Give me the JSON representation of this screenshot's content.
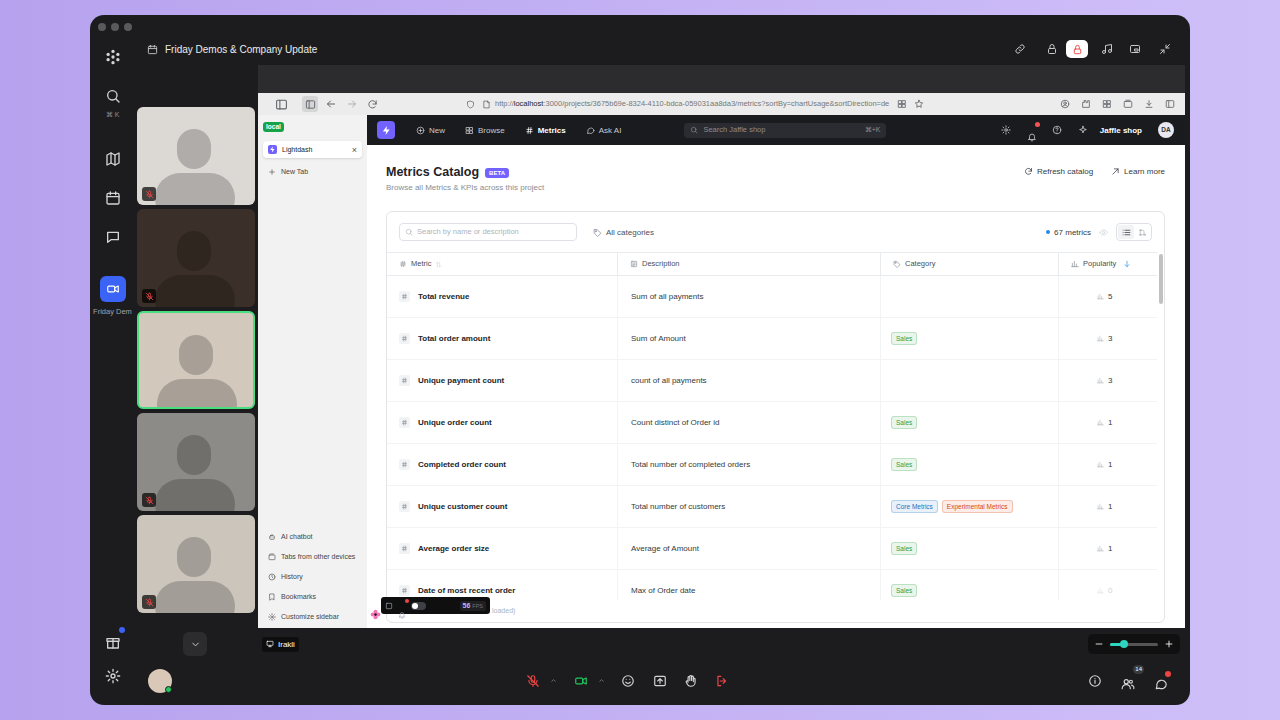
{
  "window": {
    "title": "Friday Demos & Company Update"
  },
  "rail": {
    "shortcut": "⌘ K",
    "meeting": {
      "label": "Friday Dem",
      "selected": true
    },
    "gift_dot": true
  },
  "participants": [
    {
      "muted": true,
      "speaking": false
    },
    {
      "muted": true,
      "speaking": false
    },
    {
      "muted": false,
      "speaking": true
    },
    {
      "muted": true,
      "speaking": false
    },
    {
      "muted": true,
      "speaking": false
    }
  ],
  "share": {
    "presenter": "Irakli",
    "zoom": {
      "level": 0.3
    }
  },
  "browser": {
    "url": {
      "scheme": "http://",
      "host": "localhost",
      "rest": ":3000/projects/3675b69e-8324-4110-bdca-059031aa8da3/metrics?sortBy=chartUsage&sortDirection=de"
    },
    "profile": "local",
    "tabs": [
      {
        "label": "Lightdash",
        "selected": true,
        "close": "×"
      }
    ],
    "new_tab": "New Tab",
    "links": [
      "AI chatbot",
      "Tabs from other devices",
      "History",
      "Bookmarks",
      "Customize sidebar"
    ]
  },
  "app": {
    "nav": [
      {
        "label": "New",
        "selected": false
      },
      {
        "label": "Browse",
        "selected": false
      },
      {
        "label": "Metrics",
        "selected": true
      },
      {
        "label": "Ask AI",
        "selected": false
      }
    ],
    "search": {
      "placeholder": "Search Jaffle shop",
      "shortcut": "⌘+K"
    },
    "notification_dot": true,
    "project": "Jaffle shop",
    "avatar": "DA"
  },
  "page": {
    "title": "Metrics Catalog",
    "badge": "BETA",
    "subtitle": "Browse all Metrics & KPIs across this project",
    "actions": [
      "Refresh catalog",
      "Learn more"
    ]
  },
  "table": {
    "search": {
      "placeholder": "Search by name or description"
    },
    "filter": "All categories",
    "count": "67 metrics",
    "views": [
      {
        "kind": "list",
        "selected": true
      },
      {
        "kind": "tree",
        "selected": false
      }
    ],
    "columns": [
      {
        "label": "Metric",
        "sortable": true,
        "sorted": false
      },
      {
        "label": "Description",
        "sortable": false,
        "sorted": false
      },
      {
        "label": "Category",
        "sortable": false,
        "sorted": false
      },
      {
        "label": "Popularity",
        "sortable": true,
        "sorted": true
      }
    ],
    "rows": [
      {
        "name": "Total revenue",
        "description": "Sum of all payments",
        "categories": [],
        "popularity": {
          "value": "5",
          "dim": false
        }
      },
      {
        "name": "Total order amount",
        "description": "Sum of Amount",
        "categories": [
          {
            "label": "Sales",
            "color": "#2f9e44"
          }
        ],
        "popularity": {
          "value": "3",
          "dim": false
        }
      },
      {
        "name": "Unique payment count",
        "description": "count of all payments",
        "categories": [],
        "popularity": {
          "value": "3",
          "dim": false
        }
      },
      {
        "name": "Unique order count",
        "description": "Count distinct of Order id",
        "categories": [
          {
            "label": "Sales",
            "color": "#2f9e44"
          }
        ],
        "popularity": {
          "value": "1",
          "dim": false
        }
      },
      {
        "name": "Completed order count",
        "description": "Total number of completed orders",
        "categories": [
          {
            "label": "Sales",
            "color": "#2f9e44"
          }
        ],
        "popularity": {
          "value": "1",
          "dim": false
        }
      },
      {
        "name": "Unique customer count",
        "description": "Total number of customers",
        "categories": [
          {
            "label": "Core Metrics",
            "color": "#1971c2"
          },
          {
            "label": "Experimental Metrics",
            "color": "#d9480f"
          }
        ],
        "popularity": {
          "value": "1",
          "dim": false
        }
      },
      {
        "name": "Average order size",
        "description": "Average of Amount",
        "categories": [
          {
            "label": "Sales",
            "color": "#2f9e44"
          }
        ],
        "popularity": {
          "value": "1",
          "dim": false
        }
      },
      {
        "name": "Date of most recent order",
        "description": "Max of Order date",
        "categories": [
          {
            "label": "Sales",
            "color": "#2f9e44"
          }
        ],
        "popularity": {
          "value": "0",
          "dim": true
        }
      }
    ],
    "footer": "loaded)"
  },
  "devtools": {
    "fps": "56",
    "unit": "FPS",
    "toggle_on": false,
    "alert_dot": true
  },
  "controls": {
    "self_online": true,
    "mic_muted": true,
    "camera_on": true,
    "participant_count": "14",
    "chat_unread": true
  }
}
